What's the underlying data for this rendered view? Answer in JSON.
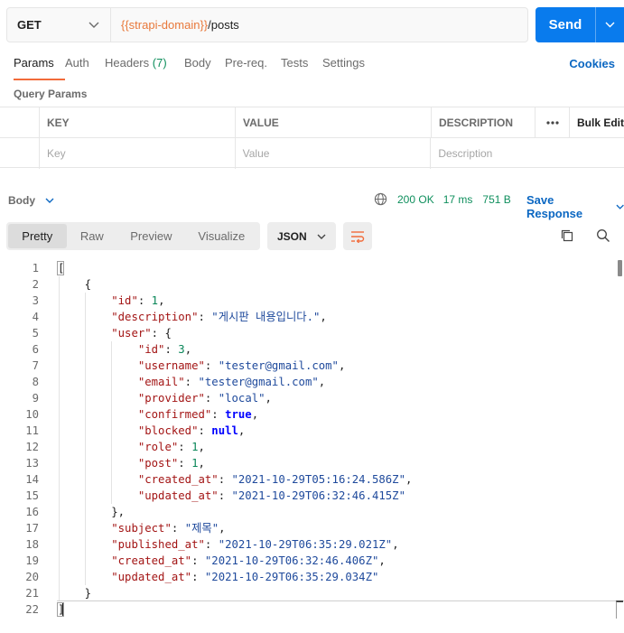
{
  "request": {
    "method": "GET",
    "url_var": "{{strapi-domain}}",
    "url_path": "/posts",
    "send_label": "Send"
  },
  "tabs": [
    {
      "label": "Params",
      "active": true
    },
    {
      "label": "Auth"
    },
    {
      "label": "Headers",
      "count": "(7)"
    },
    {
      "label": "Body"
    },
    {
      "label": "Pre-req."
    },
    {
      "label": "Tests"
    },
    {
      "label": "Settings"
    }
  ],
  "cookies_label": "Cookies",
  "query_params_title": "Query Params",
  "params_table": {
    "headers": [
      "KEY",
      "VALUE",
      "DESCRIPTION",
      "Bulk Edit"
    ],
    "placeholders": [
      "Key",
      "Value",
      "Description"
    ]
  },
  "response": {
    "body_label": "Body",
    "status": "200 OK",
    "time": "17 ms",
    "size": "751 B",
    "save_label": "Save Response",
    "view_tabs": [
      "Pretty",
      "Raw",
      "Preview",
      "Visualize"
    ],
    "active_view": "Pretty",
    "format": "JSON"
  },
  "code_lines": [
    "1",
    "2",
    "3",
    "4",
    "5",
    "6",
    "7",
    "8",
    "9",
    "10",
    "11",
    "12",
    "13",
    "14",
    "15",
    "16",
    "17",
    "18",
    "19",
    "20",
    "21",
    "22"
  ],
  "json_body": {
    "id": "1",
    "description": "\"게시판 내용입니다.\"",
    "user_id": "3",
    "username": "\"tester@gmail.com\"",
    "email": "\"tester@gmail.com\"",
    "provider": "\"local\"",
    "confirmed": "true",
    "blocked": "null",
    "role": "1",
    "post": "1",
    "user_created_at": "\"2021-10-29T05:16:24.586Z\"",
    "user_updated_at": "\"2021-10-29T06:32:46.415Z\"",
    "subject": "\"제목\"",
    "published_at": "\"2021-10-29T06:35:29.021Z\"",
    "created_at": "\"2021-10-29T06:32:46.406Z\"",
    "updated_at": "\"2021-10-29T06:35:29.034Z\""
  },
  "colors": {
    "accent_blue": "#097bed",
    "tab_underline": "#f26b3a",
    "status_green": "#0f8f5d",
    "url_variable": "#e8793b"
  }
}
